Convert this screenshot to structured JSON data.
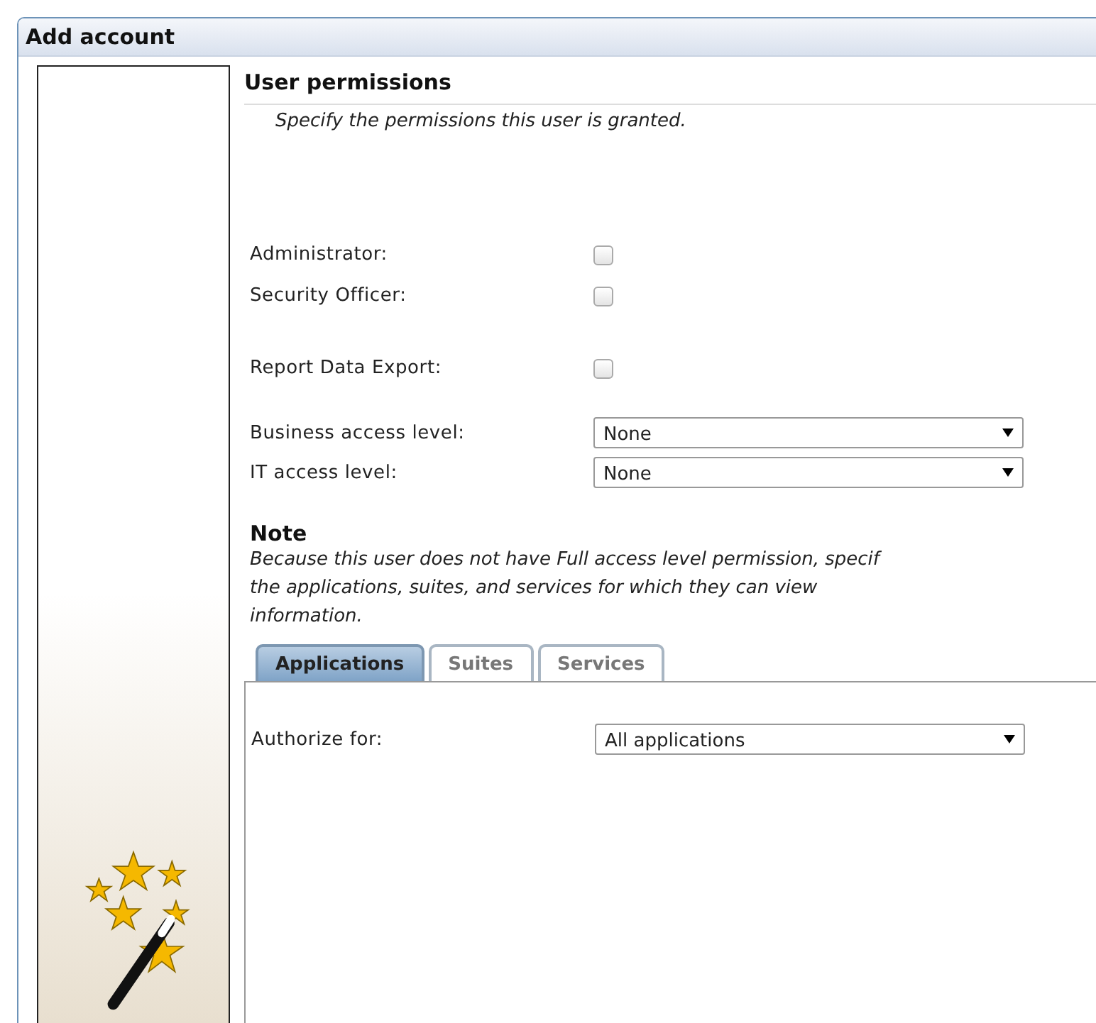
{
  "window": {
    "title": "Add account"
  },
  "section": {
    "title": "User permissions",
    "subtitle": "Specify the permissions this user is granted."
  },
  "checkbox_groups": [
    [
      {
        "label": "Administrator:",
        "checked": false
      },
      {
        "label": "Security Officer:",
        "checked": false
      }
    ],
    [
      {
        "label": "Report Data Export:",
        "checked": false
      }
    ]
  ],
  "dropdowns": [
    {
      "label": "Business access level:",
      "value": "None"
    },
    {
      "label": "IT access level:",
      "value": "None"
    }
  ],
  "note": {
    "title": "Note",
    "text": "Because this user does not have Full access level permission, specif\nthe applications, suites, and services for which they can view\ninformation."
  },
  "tabs": [
    {
      "label": "Applications",
      "selected": true
    },
    {
      "label": "Suites",
      "selected": false
    },
    {
      "label": "Services",
      "selected": false
    }
  ],
  "tab_panel": {
    "label": "Authorize for:",
    "value": "All applications"
  }
}
